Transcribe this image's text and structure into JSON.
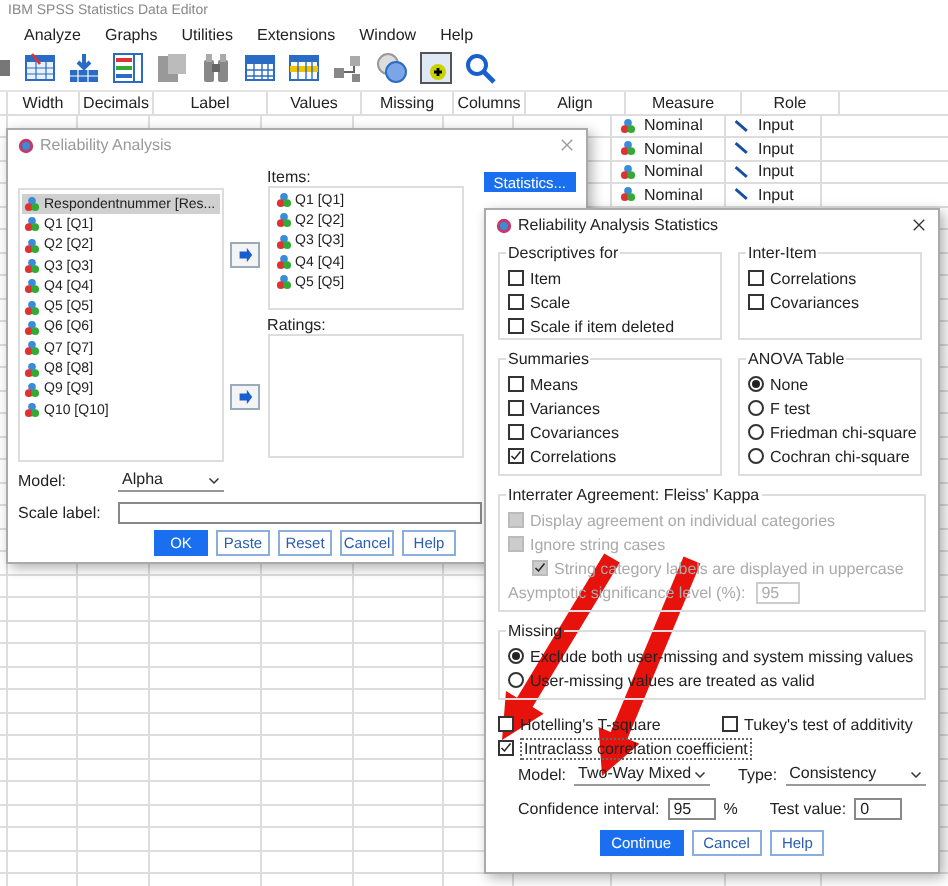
{
  "window": {
    "title": "IBM SPSS Statistics Data Editor"
  },
  "menu": [
    "Analyze",
    "Graphs",
    "Utilities",
    "Extensions",
    "Window",
    "Help"
  ],
  "columns": [
    "Width",
    "Decimals",
    "Label",
    "Values",
    "Missing",
    "Columns",
    "Align",
    "Measure",
    "Role"
  ],
  "rows": [
    {
      "measure": "Nominal",
      "role": "Input"
    },
    {
      "measure": "Nominal",
      "role": "Input"
    },
    {
      "measure": "Nominal",
      "role": "Input"
    },
    {
      "measure": "Nominal",
      "role": "Input"
    }
  ],
  "reliability": {
    "title": "Reliability Analysis",
    "variables": [
      {
        "label": "Respondentnummer [Res...",
        "selected": true
      },
      {
        "label": "Q1 [Q1]",
        "selected": false
      },
      {
        "label": "Q2 [Q2]",
        "selected": false
      },
      {
        "label": "Q3 [Q3]",
        "selected": false
      },
      {
        "label": "Q4 [Q4]",
        "selected": false
      },
      {
        "label": "Q5 [Q5]",
        "selected": false
      },
      {
        "label": "Q6 [Q6]",
        "selected": false
      },
      {
        "label": "Q7 [Q7]",
        "selected": false
      },
      {
        "label": "Q8 [Q8]",
        "selected": false
      },
      {
        "label": "Q9 [Q9]",
        "selected": false
      },
      {
        "label": "Q10 [Q10]",
        "selected": false
      }
    ],
    "items_label": "Items:",
    "items": [
      "Q1 [Q1]",
      "Q2 [Q2]",
      "Q3 [Q3]",
      "Q4 [Q4]",
      "Q5 [Q5]"
    ],
    "ratings_label": "Ratings:",
    "statistics_button": "Statistics...",
    "model_label": "Model:",
    "model_value": "Alpha",
    "scale_label": "Scale label:",
    "buttons": [
      {
        "label": "OK",
        "default": true
      },
      {
        "label": "Paste",
        "default": false
      },
      {
        "label": "Reset",
        "default": false
      },
      {
        "label": "Cancel",
        "default": false
      },
      {
        "label": "Help",
        "default": false
      }
    ]
  },
  "stats": {
    "title": "Reliability Analysis Statistics",
    "descriptives": {
      "title": "Descriptives for",
      "options": [
        {
          "label": "Item",
          "checked": false
        },
        {
          "label": "Scale",
          "checked": false
        },
        {
          "label": "Scale if item deleted",
          "checked": false
        }
      ]
    },
    "inter_item": {
      "title": "Inter-Item",
      "options": [
        {
          "label": "Correlations",
          "checked": false
        },
        {
          "label": "Covariances",
          "checked": false
        }
      ]
    },
    "summaries": {
      "title": "Summaries",
      "options": [
        {
          "label": "Means",
          "checked": false
        },
        {
          "label": "Variances",
          "checked": false
        },
        {
          "label": "Covariances",
          "checked": false
        },
        {
          "label": "Correlations",
          "checked": true
        }
      ]
    },
    "anova": {
      "title": "ANOVA Table",
      "options": [
        {
          "label": "None",
          "selected": true
        },
        {
          "label": "F test",
          "selected": false
        },
        {
          "label": "Friedman chi-square",
          "selected": false
        },
        {
          "label": "Cochran chi-square",
          "selected": false
        }
      ]
    },
    "interrater": {
      "title": "Interrater Agreement: Fleiss' Kappa",
      "options": [
        {
          "label": "Display agreement on individual categories",
          "checked": false,
          "disabled": true
        },
        {
          "label": "Ignore string cases",
          "checked": false,
          "disabled": true,
          "children": [
            {
              "label": "String category labels are displayed in uppercase",
              "checked": true,
              "disabled": true
            }
          ]
        }
      ],
      "asymptotic_label": "Asymptotic significance level (%):",
      "asymptotic_value": "95",
      "disabled": true
    },
    "missing": {
      "title": "Missing",
      "options": [
        {
          "label": "Exclude both user-missing and system missing values",
          "selected": true
        },
        {
          "label": "User-missing values are treated as valid",
          "selected": false
        }
      ]
    },
    "extras": [
      {
        "label": "Hotelling's T-square",
        "checked": false
      },
      {
        "label": "Tukey's test of additivity",
        "checked": false
      }
    ],
    "intraclass": {
      "label": "Intraclass correlation coefficient",
      "checked": true
    },
    "model_label": "Model:",
    "model_value": "Two-Way Mixed",
    "type_label": "Type:",
    "type_value": "Consistency",
    "confidence_label": "Confidence interval:",
    "confidence_value": "95",
    "percent": "%",
    "test_label": "Test value:",
    "test_value": "0",
    "buttons": [
      {
        "label": "Continue",
        "default": true
      },
      {
        "label": "Cancel",
        "default": false
      },
      {
        "label": "Help",
        "default": false
      }
    ]
  }
}
